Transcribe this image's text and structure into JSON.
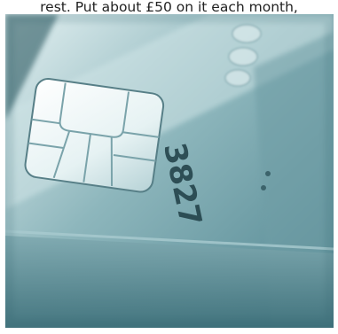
{
  "caption": {
    "text": "rest. Put about £50 on it each month,"
  },
  "image": {
    "subject": "credit-card-chip",
    "card_number_digits": "3827",
    "colors": {
      "dark_teal": "#2f5f69",
      "mid_teal": "#6e9ca4",
      "light_teal": "#dcecee",
      "chip_highlight": "#f6fbfb"
    }
  }
}
